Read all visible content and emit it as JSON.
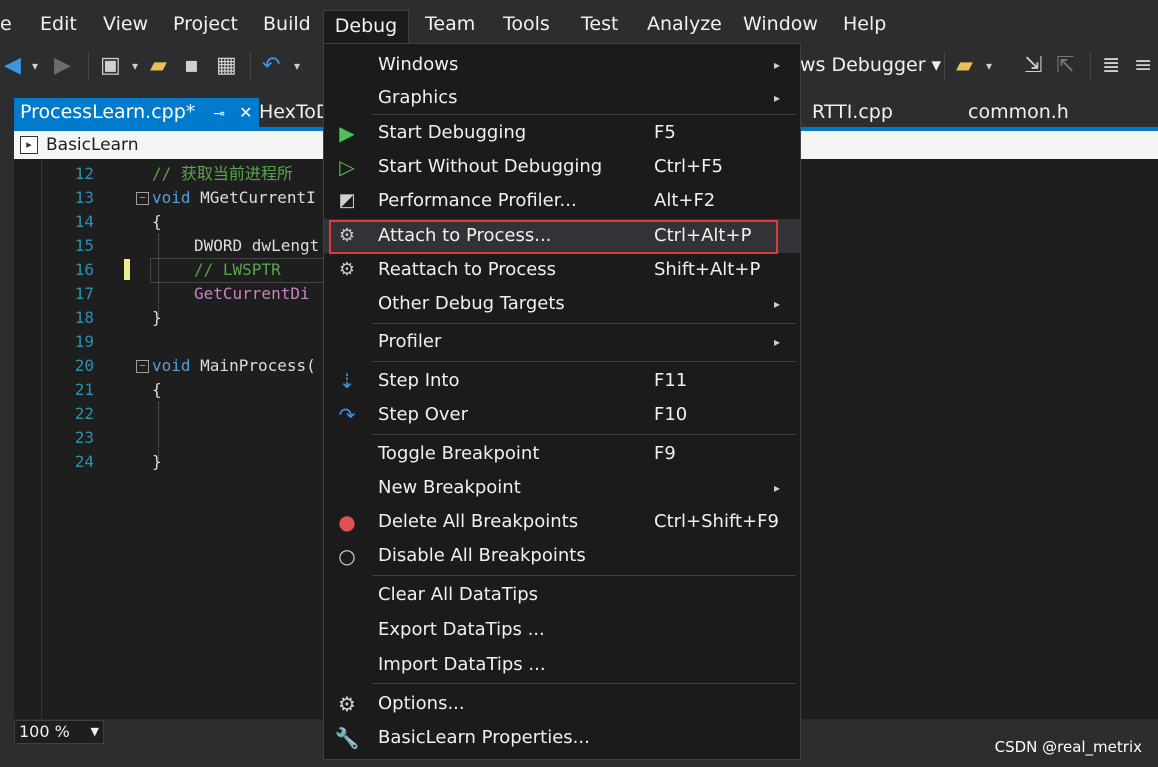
{
  "menubar": {
    "items": [
      "e",
      "Edit",
      "View",
      "Project",
      "Build",
      "Debug",
      "Team",
      "Tools",
      "Test",
      "Analyze",
      "Window",
      "Help"
    ]
  },
  "toolbar": {
    "debugger_target": "ws Debugger ▾"
  },
  "tabs": [
    {
      "label": "ProcessLearn.cpp*",
      "pin": "⊸",
      "close": "✕"
    },
    {
      "label": "HexToD"
    },
    {
      "label": "RTTI.cpp"
    },
    {
      "label": "common.h"
    }
  ],
  "navbar": {
    "project": "BasicLearn"
  },
  "editor": {
    "line_numbers": [
      "12",
      "13",
      "14",
      "15",
      "16",
      "17",
      "18",
      "19",
      "20",
      "21",
      "22",
      "23",
      "24"
    ],
    "lines": {
      "l12": "// 获取当前进程所",
      "l13_kw": "void",
      "l13_rest": " MGetCurrentI",
      "l14": "{",
      "l15": "DWORD dwLengt",
      "l16": "// LWSPTR",
      "l17": "GetCurrentDi",
      "l18": "}",
      "l20_kw": "void",
      "l20_rest": " MainProcess(",
      "l21": "{",
      "l24": "}"
    }
  },
  "zoom": {
    "value": "100 %"
  },
  "watermark": "CSDN @real_metrix",
  "debug_menu": {
    "items": [
      {
        "label": "Windows",
        "shortcut": "",
        "submenu": true
      },
      {
        "label": "Graphics",
        "shortcut": "",
        "submenu": true
      },
      {
        "label": "Start Debugging",
        "shortcut": "F5",
        "icon": "play-icon"
      },
      {
        "label": "Start Without Debugging",
        "shortcut": "Ctrl+F5",
        "icon": "play-outline-icon"
      },
      {
        "label": "Performance Profiler...",
        "shortcut": "Alt+F2",
        "icon": "profiler-icon"
      },
      {
        "label": "Attach to Process...",
        "shortcut": "Ctrl+Alt+P",
        "icon": "gears-icon"
      },
      {
        "label": "Reattach to Process",
        "shortcut": "Shift+Alt+P",
        "icon": "gears-icon"
      },
      {
        "label": "Other Debug Targets",
        "shortcut": "",
        "submenu": true
      },
      {
        "label": "Profiler",
        "shortcut": "",
        "submenu": true
      },
      {
        "label": "Step Into",
        "shortcut": "F11",
        "icon": "step-into-icon"
      },
      {
        "label": "Step Over",
        "shortcut": "F10",
        "icon": "step-over-icon"
      },
      {
        "label": "Toggle Breakpoint",
        "shortcut": "F9"
      },
      {
        "label": "New Breakpoint",
        "shortcut": "",
        "submenu": true
      },
      {
        "label": "Delete All Breakpoints",
        "shortcut": "Ctrl+Shift+F9",
        "icon": "delete-breakpoints-icon"
      },
      {
        "label": "Disable All Breakpoints",
        "shortcut": "",
        "icon": "disable-breakpoints-icon"
      },
      {
        "label": "Clear All DataTips",
        "shortcut": ""
      },
      {
        "label": "Export DataTips ...",
        "shortcut": ""
      },
      {
        "label": "Import DataTips ...",
        "shortcut": ""
      },
      {
        "label": "Options...",
        "shortcut": "",
        "icon": "gear-icon"
      },
      {
        "label": "BasicLearn Properties...",
        "shortcut": "",
        "icon": "wrench-icon"
      }
    ],
    "arrow": "▸",
    "highlight_color": "#e0393e"
  }
}
